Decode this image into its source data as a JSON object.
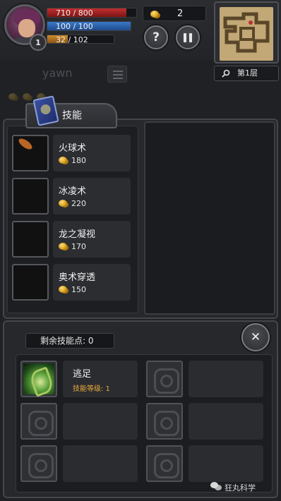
{
  "player": {
    "level": "1",
    "hp": "710 / 800",
    "hp_fraction": 0.8875,
    "mp": "100 / 100",
    "mp_fraction": 1.0,
    "xp": "32 / 102",
    "xp_fraction": 0.3137
  },
  "gold": "2",
  "buttons": {
    "help": "?"
  },
  "floor": "第1层",
  "chat": {
    "text": "yawn"
  },
  "skills_tab": {
    "label": "技能"
  },
  "skills": [
    {
      "name": "火球术",
      "cost": "180",
      "icon": "fireball-icon"
    },
    {
      "name": "冰凌术",
      "cost": "220",
      "icon": "ice-shard-icon"
    },
    {
      "name": "龙之凝视",
      "cost": "170",
      "icon": "dragon-eye-icon"
    },
    {
      "name": "奥术穿透",
      "cost": "150",
      "icon": "arcane-pierce-icon"
    }
  ],
  "talents": {
    "remaining_points": "剩余技能点: 0",
    "close": "✕",
    "items": [
      {
        "name": "逃足",
        "level": "技能等级: 1",
        "icon": "leaf-icon",
        "unlocked": true
      },
      {
        "icon": "locked-swirl-icon",
        "unlocked": false
      },
      {
        "icon": "locked-swirl-icon",
        "unlocked": false
      },
      {
        "icon": "locked-swirl-icon",
        "unlocked": false
      },
      {
        "icon": "locked-swirl-icon",
        "unlocked": false
      },
      {
        "icon": "locked-swirl-icon",
        "unlocked": false
      }
    ]
  },
  "watermark": "狂丸科学",
  "colors": {
    "hp": "#c23030",
    "mp": "#3a78c8",
    "xp": "#cf8a2a",
    "gold": "#d49a18",
    "talent_level": "#e8a93a"
  }
}
